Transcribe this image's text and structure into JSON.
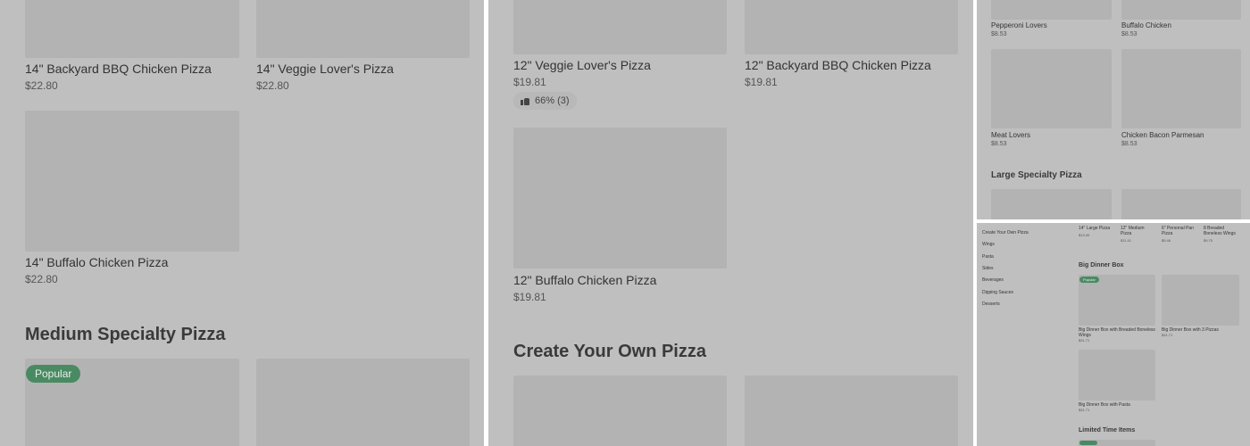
{
  "panel1": {
    "items": [
      {
        "name": "14\" Backyard BBQ Chicken Pizza",
        "price": "$22.80"
      },
      {
        "name": "14\" Veggie Lover's Pizza",
        "price": "$22.80"
      },
      {
        "name": "14\" Buffalo Chicken Pizza",
        "price": "$22.80"
      }
    ],
    "section_heading": "Medium Specialty Pizza",
    "popular_badge": "Popular"
  },
  "panel2": {
    "items": [
      {
        "name": "12\" Veggie Lover's Pizza",
        "price": "$19.81"
      },
      {
        "name": "12\" Backyard BBQ Chicken Pizza",
        "price": "$19.81"
      },
      {
        "name": "12\" Buffalo Chicken Pizza",
        "price": "$19.81"
      }
    ],
    "rating": "66% (3)",
    "section_heading": "Create Your Own Pizza"
  },
  "panel3": {
    "items": [
      {
        "name": "Pepperoni Lovers",
        "price": "$8.53"
      },
      {
        "name": "Buffalo Chicken",
        "price": "$8.53"
      },
      {
        "name": "Meat Lovers",
        "price": "$8.53"
      },
      {
        "name": "Chicken Bacon Parmesan",
        "price": "$8.53"
      }
    ],
    "section_heading": "Large Specialty Pizza"
  },
  "panel4": {
    "sidebar": [
      "Create Your Own Pizza",
      "Wings",
      "Pasta",
      "Sides",
      "Beverages",
      "Dipping Sauces",
      "Desserts"
    ],
    "top_items": [
      {
        "name": "14\" Large Pizza",
        "price": "$13.40"
      },
      {
        "name": "12\" Medium Pizza",
        "price": "$11.41"
      },
      {
        "name": "6\" Personal Pan Pizza",
        "price": "$5.46"
      },
      {
        "name": "8 Breaded Boneless Wings",
        "price": "$9.75"
      }
    ],
    "big_dinner_heading": "Big Dinner Box",
    "popular_badge": "Popular",
    "big_dinner_items": [
      {
        "name": "Big Dinner Box with Breaded Boneless Wings",
        "price": "$31.71"
      },
      {
        "name": "Big Dinner Box with 3 Pizzas",
        "price": "$31.71"
      },
      {
        "name": "Big Dinner Box with Pasta",
        "price": "$31.71"
      }
    ],
    "limited_heading": "Limited Time Items"
  }
}
